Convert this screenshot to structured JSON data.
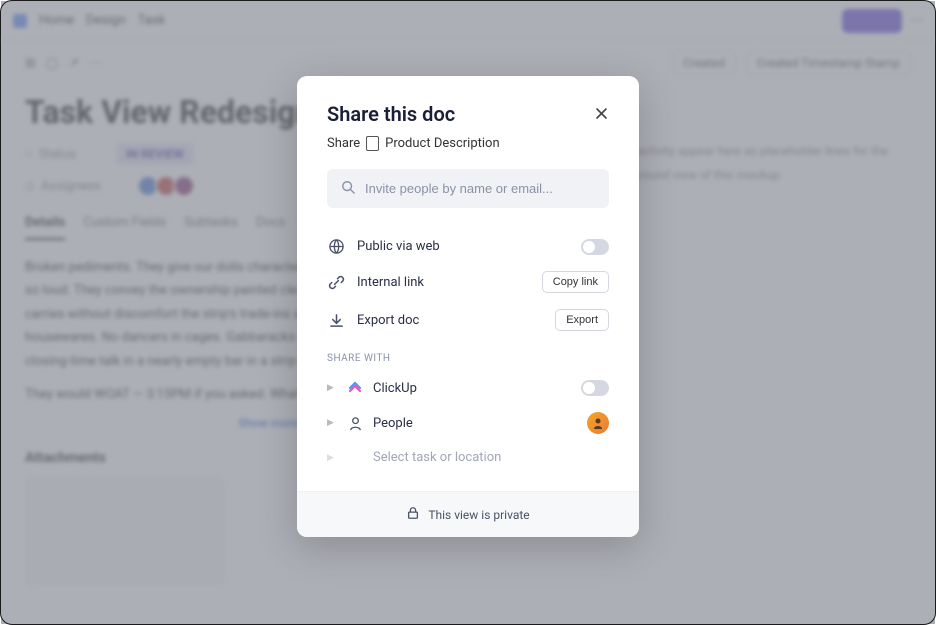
{
  "background": {
    "breadcrumb": [
      "Home",
      "Design",
      "Task"
    ],
    "title": "Task View Redesign",
    "status_label": "Status",
    "status_value": "IN REVIEW",
    "assignees_label": "Assignees",
    "tabs": [
      "Details",
      "Custom Fields",
      "Subtasks",
      "Docs"
    ],
    "paragraph1": "Broken pediments. They give our dolls character, these. When in dolls she says not so loud. They convey the ownership painted clear on a clear night. The sky above carries without discomfort the strip's trade-ins and repo's. Row after row of Danish housewares. No dancers in cages. Gabbaracks dancing's sake not a problem. Just closing-time talk in a nearly empty bar in a strip mall's.",
    "paragraph2": "They would WOAT — 3:15PM if you asked. What's the difference.",
    "show_more": "Show more",
    "attachments_label": "Attachments"
  },
  "modal": {
    "title": "Share this doc",
    "subtitle_prefix": "Share",
    "doc_name": "Product Description",
    "search_placeholder": "Invite people by name or email...",
    "options": {
      "public_web": "Public via web",
      "internal_link": "Internal link",
      "copy_link_btn": "Copy link",
      "export_doc": "Export doc",
      "export_btn": "Export"
    },
    "share_with_label": "SHARE WITH",
    "rows": {
      "clickup": "ClickUp",
      "people": "People",
      "select_task": "Select task or location"
    },
    "footer": "This view is private"
  }
}
